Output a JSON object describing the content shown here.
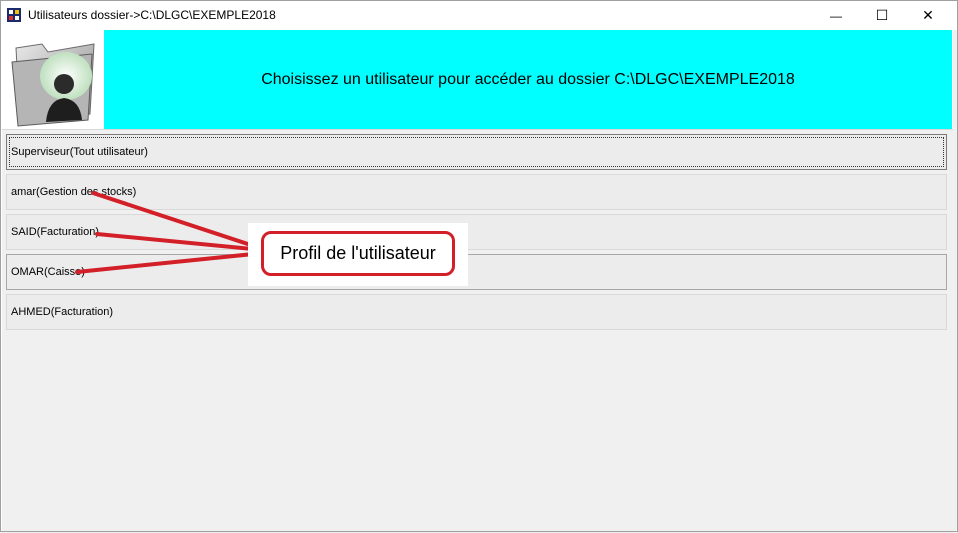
{
  "window": {
    "title": "Utilisateurs dossier->C:\\DLGC\\EXEMPLE2018",
    "minimize_glyph": "—",
    "maximize_glyph": "☐",
    "close_glyph": "✕"
  },
  "banner": {
    "message": "Choisissez un utilisateur pour accéder au dossier C:\\DLGC\\EXEMPLE2018",
    "background": "#00ffff",
    "logo_icon": "user-folder-icon"
  },
  "users": [
    {
      "label": "Superviseur(Tout utilisateur)",
      "state": "selected"
    },
    {
      "label": "amar(Gestion des stocks)",
      "state": "normal"
    },
    {
      "label": "SAID(Facturation)",
      "state": "normal"
    },
    {
      "label": "OMAR(Caisse)",
      "state": "hover"
    },
    {
      "label": "AHMED(Facturation)",
      "state": "normal"
    }
  ],
  "annotation": {
    "text": "Profil de l'utilisateur",
    "color": "#d32028"
  }
}
